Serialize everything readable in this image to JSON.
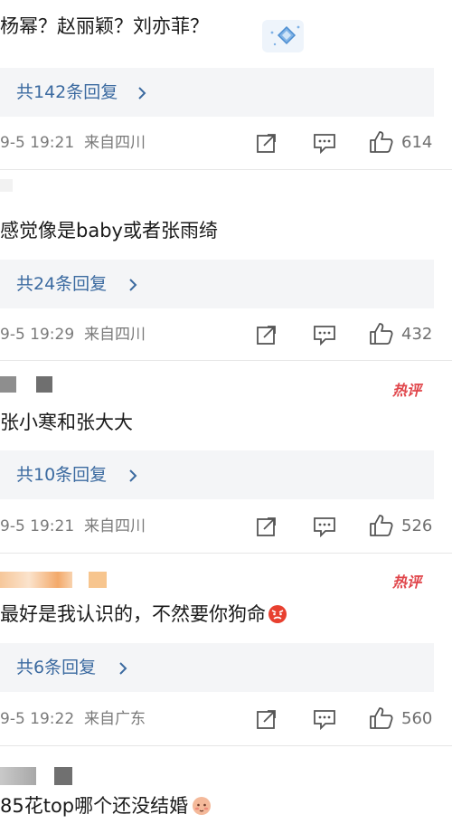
{
  "comments": [
    {
      "text": "杨幂？赵丽颖？刘亦菲？",
      "replies_label": "共142条回复",
      "time": "9-5 19:21",
      "location": "来自四川",
      "likes": "614"
    },
    {
      "text": "感觉像是baby或者张雨绮",
      "replies_label": "共24条回复",
      "time": "9-5 19:29",
      "location": "来自四川",
      "likes": "432"
    },
    {
      "text": "张小寒和张大大",
      "replies_label": "共10条回复",
      "time": "9-5 19:21",
      "location": "来自四川",
      "likes": "526",
      "badge": "热评"
    },
    {
      "text": "最好是我认识的，不然要你狗命",
      "replies_label": "共6条回复",
      "time": "9-5 19:22",
      "location": "来自广东",
      "likes": "560",
      "badge": "热评"
    },
    {
      "text": "85花top哪个还没结婚"
    }
  ],
  "icons": {
    "share": "share-icon",
    "comment": "comment-icon",
    "like": "thumbs-up-icon",
    "reply_chevron": "chevron-right-icon",
    "diamond": "diamond-icon",
    "angry_emoji": "angry-face-icon",
    "shy_emoji": "shy-face-icon"
  },
  "colors": {
    "reply_link": "#3b6aa0",
    "reply_bg": "#f4f5f7",
    "meta": "#7a7a7a",
    "hot_badge": "#e0454a"
  }
}
